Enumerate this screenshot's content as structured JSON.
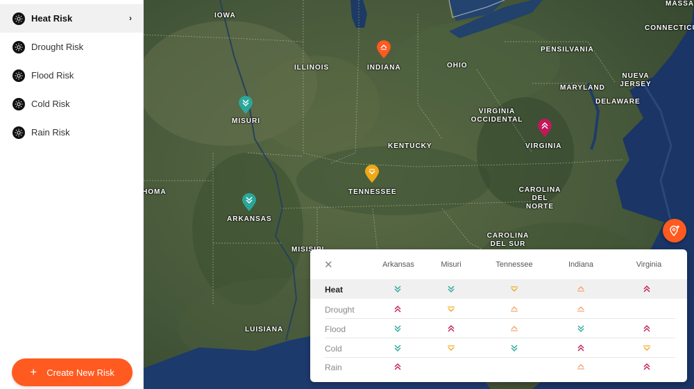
{
  "sidebar": {
    "items": [
      {
        "label": "Heat Risk",
        "active": true
      },
      {
        "label": "Drought Risk",
        "active": false
      },
      {
        "label": "Flood Risk",
        "active": false
      },
      {
        "label": "Cold Risk",
        "active": false
      },
      {
        "label": "Rain Risk",
        "active": false
      }
    ],
    "create_label": "Create New Risk",
    "create_icon": "plus-icon"
  },
  "colors": {
    "accent": "#ff5a1f",
    "teal": "#2aa79b",
    "orange": "#ff5a1f",
    "yellow": "#f0a818",
    "magenta": "#c2185b",
    "peach": "#f5a06b"
  },
  "map": {
    "labels": [
      "IOWA",
      "ILLINOIS",
      "INDIANA",
      "OHIO",
      "PENSILVANIA",
      "NUEVA JERSEY",
      "MARYLAND",
      "DELAWARE",
      "VIRGINIA OCCIDENTAL",
      "VIRGINIA",
      "KENTUCKY",
      "TENNESSEE",
      "MISURI",
      "ARKANSAS",
      "HOMA",
      "CAROLINA DEL NORTE",
      "CAROLINA DEL SUR",
      "MISISIPI",
      "LUISIANA",
      "CONNECTICUT",
      "MASSA"
    ],
    "pins": [
      {
        "state": "INDIANA",
        "color": "orange",
        "icon": "up-icon"
      },
      {
        "state": "MISURI",
        "color": "teal",
        "icon": "double-down-icon"
      },
      {
        "state": "ARKANSAS",
        "color": "teal",
        "icon": "double-down-icon"
      },
      {
        "state": "TENNESSEE",
        "color": "yellow",
        "icon": "down-icon"
      },
      {
        "state": "VIRGINIA",
        "color": "magenta",
        "icon": "double-up-icon"
      }
    ]
  },
  "table": {
    "columns": [
      "Arkansas",
      "Misuri",
      "Tennessee",
      "Indiana",
      "Virginia"
    ],
    "rows": [
      {
        "label": "Heat",
        "cells": [
          "dd-teal",
          "dd-teal",
          "d-yellow",
          "u-peach",
          "uu-magenta"
        ]
      },
      {
        "label": "Drought",
        "cells": [
          "uu-magenta",
          "d-yellow",
          "u-peach",
          "u-peach",
          ""
        ]
      },
      {
        "label": "Flood",
        "cells": [
          "dd-teal",
          "uu-magenta",
          "u-peach",
          "dd-teal",
          "uu-magenta"
        ]
      },
      {
        "label": "Cold",
        "cells": [
          "dd-teal",
          "d-yellow",
          "dd-teal",
          "uu-magenta",
          "d-yellow"
        ]
      },
      {
        "label": "Rain",
        "cells": [
          "uu-magenta",
          "",
          "",
          "u-peach",
          "uu-magenta"
        ]
      }
    ]
  }
}
